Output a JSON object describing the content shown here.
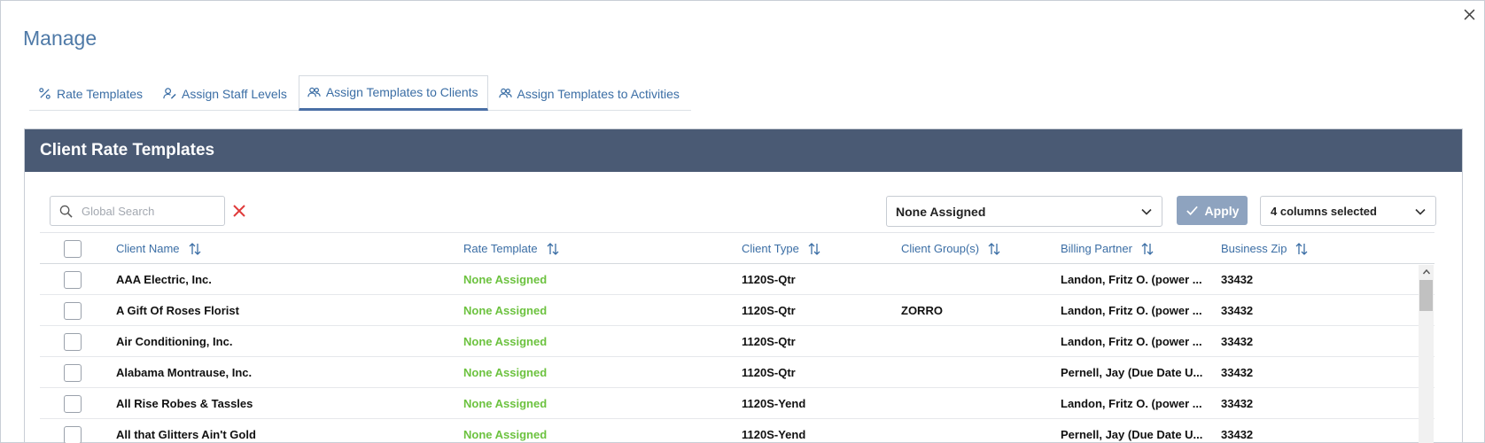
{
  "dialog": {
    "title": "Manage"
  },
  "tabs": [
    {
      "label": "Rate Templates",
      "icon": "percent-icon",
      "active": false
    },
    {
      "label": "Assign Staff Levels",
      "icon": "user-edit-icon",
      "active": false
    },
    {
      "label": "Assign Templates to Clients",
      "icon": "users-icon",
      "active": true
    },
    {
      "label": "Assign Templates to Activities",
      "icon": "users-icon",
      "active": false
    }
  ],
  "panel": {
    "title": "Client Rate Templates"
  },
  "toolbar": {
    "search_placeholder": "Global Search",
    "template_filter_value": "None Assigned",
    "apply_label": "Apply",
    "columns_label": "4 columns selected"
  },
  "grid": {
    "columns": [
      "Client Name",
      "Rate Template",
      "Client Type",
      "Client Group(s)",
      "Billing Partner",
      "Business Zip"
    ],
    "rows": [
      {
        "name": "AAA Electric, Inc.",
        "template": "None Assigned",
        "type": "1120S-Qtr",
        "group": "",
        "partner": "Landon, Fritz O. (power ...",
        "zip": "33432"
      },
      {
        "name": "A Gift Of Roses Florist",
        "template": "None Assigned",
        "type": "1120S-Qtr",
        "group": "ZORRO",
        "partner": "Landon, Fritz O. (power ...",
        "zip": "33432"
      },
      {
        "name": "Air Conditioning, Inc.",
        "template": "None Assigned",
        "type": "1120S-Qtr",
        "group": "",
        "partner": "Landon, Fritz O. (power ...",
        "zip": "33432"
      },
      {
        "name": "Alabama Montrause, Inc.",
        "template": "None Assigned",
        "type": "1120S-Qtr",
        "group": "",
        "partner": "Pernell, Jay (Due Date U...",
        "zip": "33432"
      },
      {
        "name": "All Rise Robes & Tassles",
        "template": "None Assigned",
        "type": "1120S-Yend",
        "group": "",
        "partner": "Landon, Fritz O. (power ...",
        "zip": "33432"
      },
      {
        "name": "All that Glitters Ain't Gold",
        "template": "None Assigned",
        "type": "1120S-Yend",
        "group": "",
        "partner": "Pernell, Jay (Due Date U...",
        "zip": "33432"
      }
    ]
  },
  "colors": {
    "accent": "#4e79a7",
    "header_bg": "#4a5a74",
    "template_green": "#6cc23f",
    "apply_bg": "#8ea3bf",
    "clear_red": "#e03b3b"
  }
}
